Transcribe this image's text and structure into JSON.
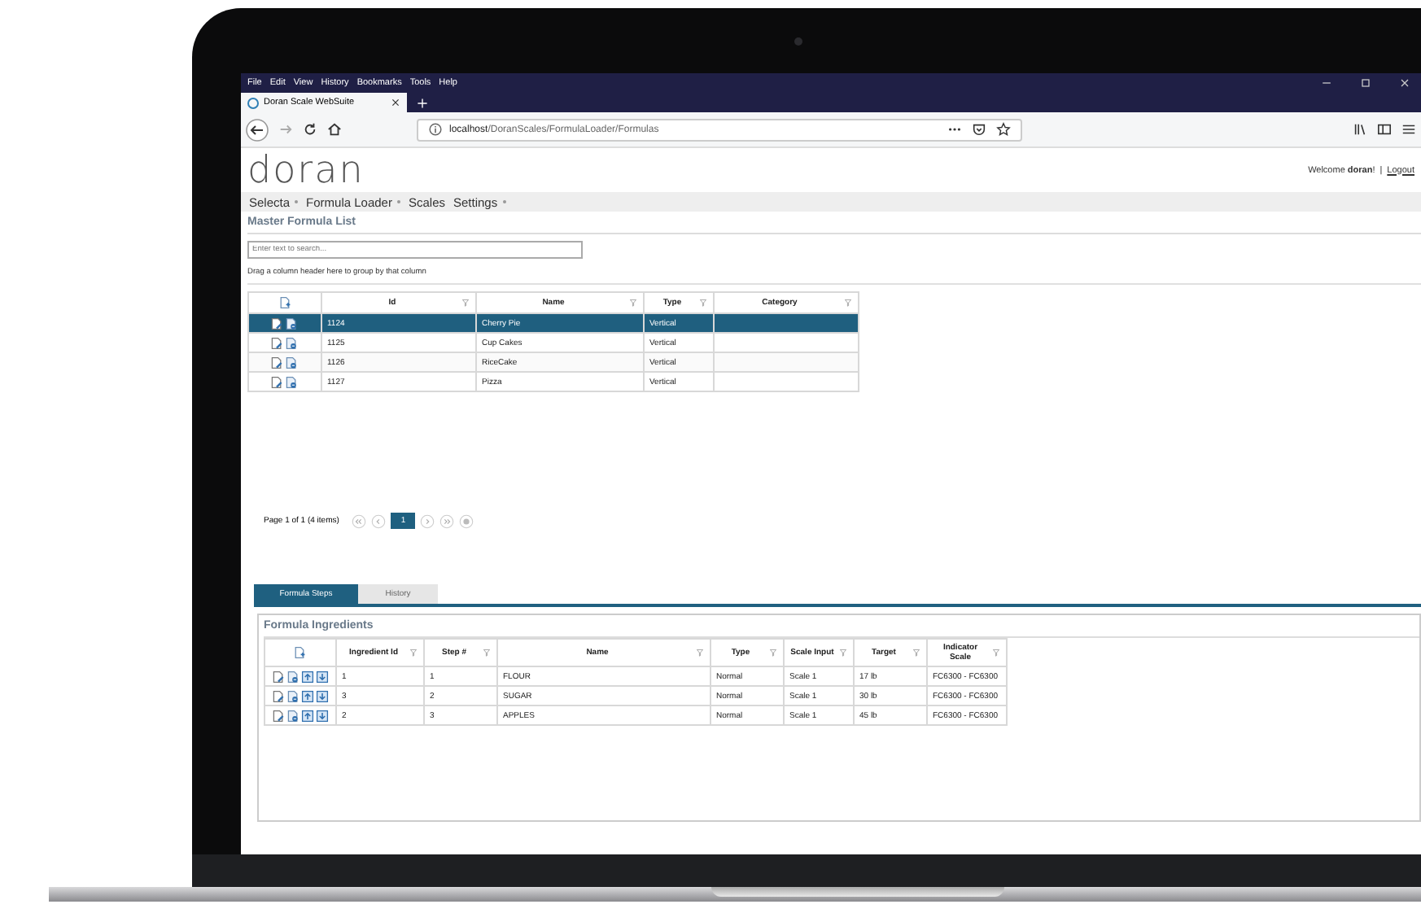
{
  "browser": {
    "menu": [
      "File",
      "Edit",
      "View",
      "History",
      "Bookmarks",
      "Tools",
      "Help"
    ],
    "tab": {
      "title": "Doran Scale WebSuite"
    },
    "url": "**localhost**/DoranScales/FormulaLoader/Formulas"
  },
  "header": {
    "logo": "doran",
    "welcome": "Welcome **doran**!",
    "separator": "|",
    "logout": "Logout"
  },
  "nav": [
    {
      "label": "Selecta",
      "dropdown": true
    },
    {
      "label": "Formula Loader",
      "dropdown": true
    },
    {
      "label": "Scales",
      "dropdown": false
    },
    {
      "label": "Settings",
      "dropdown": true
    }
  ],
  "master": {
    "title": "Master Formula List",
    "search": {
      "placeholder": "Enter text to search..."
    },
    "group_hint": "Drag a column header here to group by that column",
    "columns": [
      "Id",
      "Name",
      "Type",
      "Category"
    ],
    "rows": [
      {
        "id": "1124",
        "name": "Cherry Pie",
        "type": "Vertical",
        "selected": true
      },
      {
        "id": "1125",
        "name": "Cup Cakes",
        "type": "Vertical",
        "selected": false
      },
      {
        "id": "1126",
        "name": "RiceCake",
        "type": "Vertical",
        "selected": false
      },
      {
        "id": "1127",
        "name": "Pizza",
        "type": "Vertical",
        "selected": false
      }
    ],
    "pager": {
      "summary": "Page 1 of 1 (4 items)",
      "pages": [
        {
          "label": "1",
          "selected": true
        }
      ]
    }
  },
  "tabs": [
    {
      "label": "Formula Steps",
      "selected": true
    },
    {
      "label": "History",
      "selected": false
    }
  ],
  "ingredients": {
    "title": "Formula Ingredients",
    "columns": [
      "Ingredient Id",
      "Step #",
      "Name",
      "Type",
      "Scale Input",
      "Target",
      "Indicator Scale"
    ],
    "rows": [
      [
        "1",
        "1",
        "FLOUR",
        "Normal",
        "Scale 1",
        "17 lb",
        "FC6300 - FC6300"
      ],
      [
        "3",
        "2",
        "SUGAR",
        "Normal",
        "Scale 1",
        "30 lb",
        "FC6300 - FC6300"
      ],
      [
        "2",
        "3",
        "APPLES",
        "Normal",
        "Scale 1",
        "45 lb",
        "FC6300 - FC6300"
      ]
    ]
  }
}
